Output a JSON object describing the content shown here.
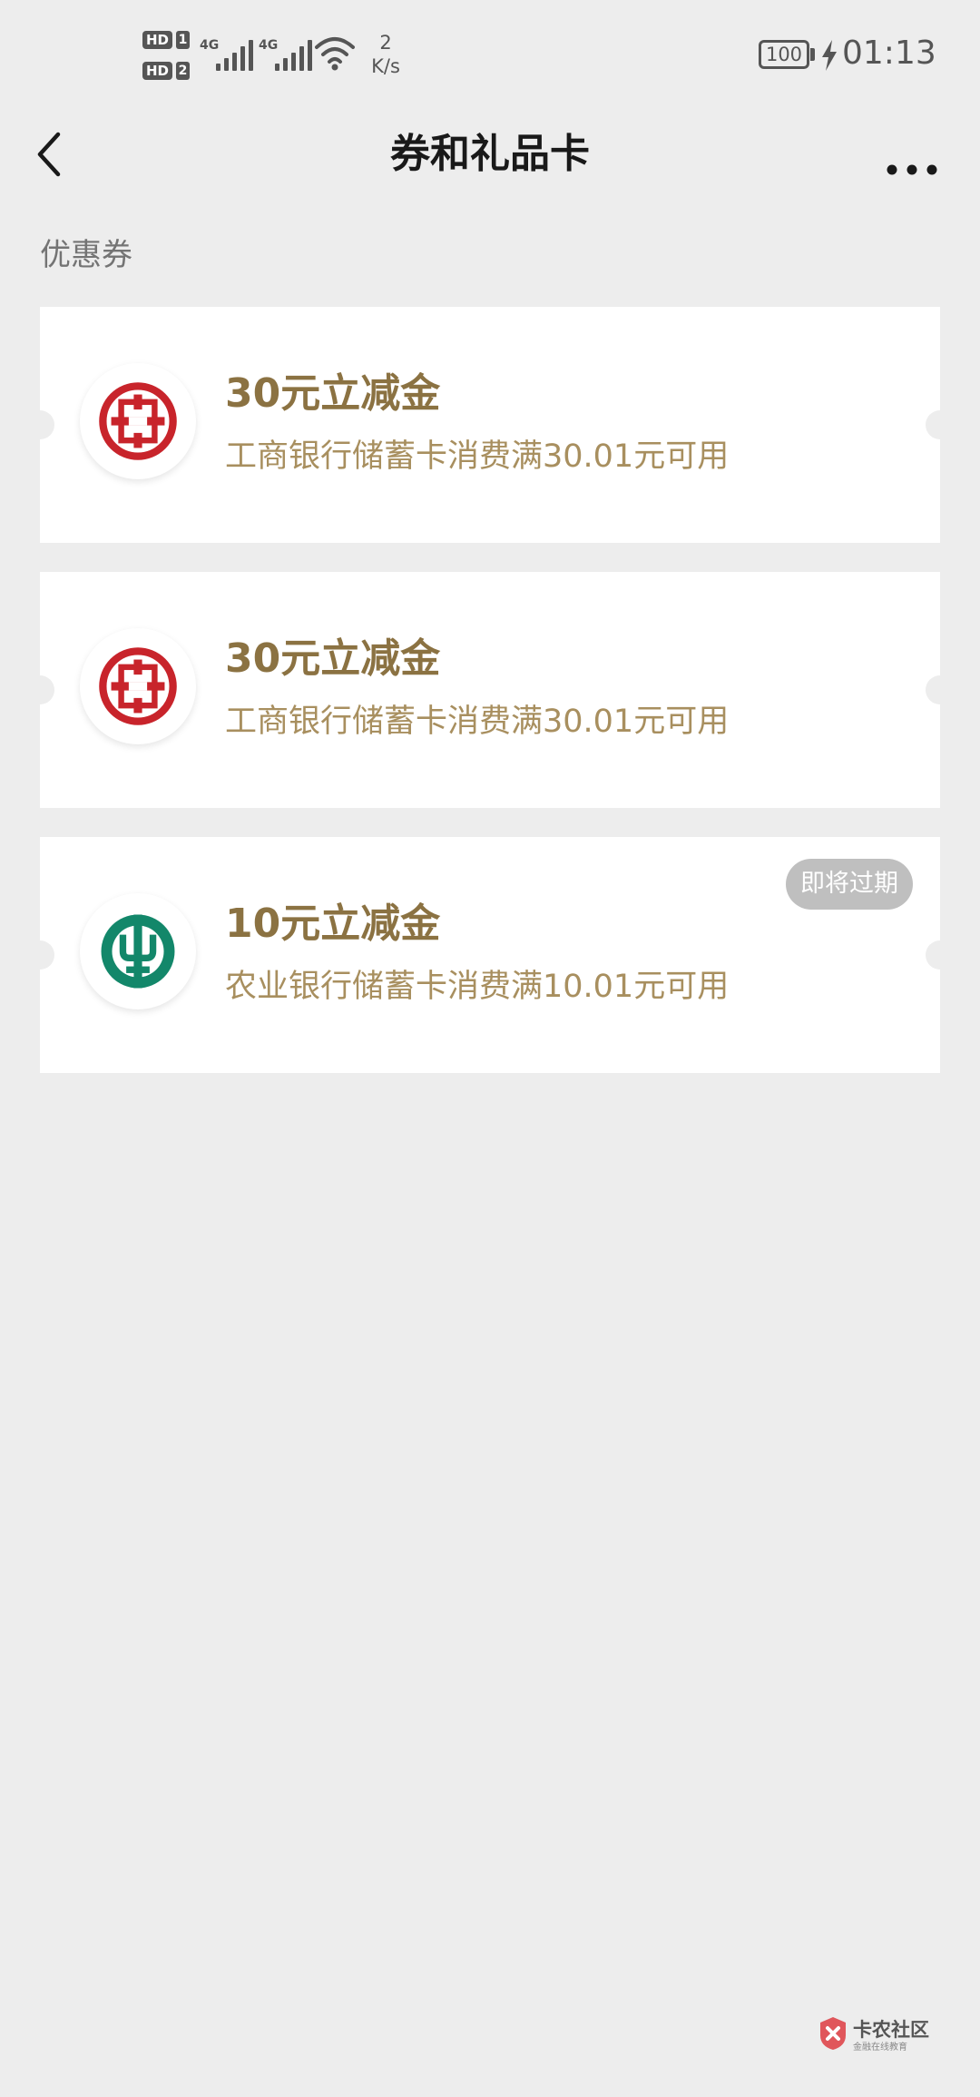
{
  "status_bar": {
    "hd_label": "HD",
    "sim1": "1",
    "sim2": "2",
    "network1": "4G",
    "network2": "4G",
    "speed_value": "2",
    "speed_unit": "K/s",
    "battery": "100",
    "time": "01:13"
  },
  "nav": {
    "title": "券和礼品卡",
    "back_icon": "chevron-left-icon",
    "more_icon": "more-dots-icon"
  },
  "section": {
    "title": "优惠券"
  },
  "coupons": [
    {
      "amount": "30元立减金",
      "description": "工商银行储蓄卡消费满30.01元可用",
      "bank_icon": "icbc-logo-icon",
      "badge": ""
    },
    {
      "amount": "30元立减金",
      "description": "工商银行储蓄卡消费满30.01元可用",
      "bank_icon": "icbc-logo-icon",
      "badge": ""
    },
    {
      "amount": "10元立减金",
      "description": "农业银行储蓄卡消费满10.01元可用",
      "bank_icon": "abc-logo-icon",
      "badge": "即将过期"
    }
  ],
  "watermark": {
    "name": "卡农社区",
    "tagline": "金融在线教育"
  },
  "colors": {
    "background": "#ededed",
    "card": "#ffffff",
    "amount": "#8b7242",
    "description": "#a88f5f",
    "icbc_red": "#c8242b",
    "abc_green": "#13876a",
    "badge_bg": "#bfbfbf"
  }
}
